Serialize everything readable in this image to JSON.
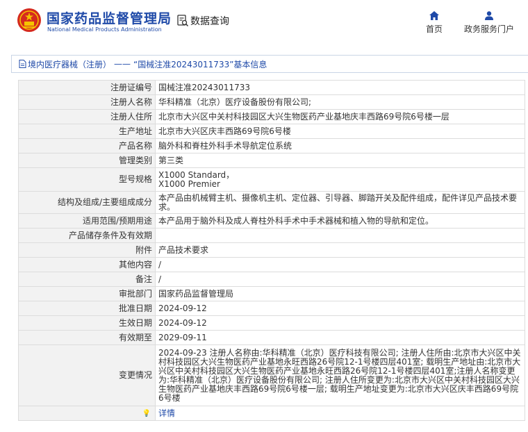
{
  "header": {
    "site_title": "国家药品监督管理局",
    "site_subtitle": "National Medical Products Administration",
    "data_query_label": "数据查询",
    "nav": [
      {
        "label": "首页",
        "icon": "home-icon"
      },
      {
        "label": "政务服务门户",
        "icon": "user-icon"
      }
    ],
    "accent_color": "#1f4aa8"
  },
  "breadcrumb": {
    "section_link": "境内医疗器械（注册）",
    "separator": "——",
    "title": "“国械注准20243011733”基本信息"
  },
  "rows": [
    {
      "label": "注册证编号",
      "value": "国械注准20243011733"
    },
    {
      "label": "注册人名称",
      "value": "华科精准（北京）医疗设备股份有限公司;"
    },
    {
      "label": "注册人住所",
      "value": "北京市大兴区中关村科技园区大兴生物医药产业基地庆丰西路69号院6号楼一层"
    },
    {
      "label": "生产地址",
      "value": "北京市大兴区庆丰西路69号院6号楼"
    },
    {
      "label": "产品名称",
      "value": "脑外科和脊柱外科手术导航定位系统"
    },
    {
      "label": "管理类别",
      "value": "第三类"
    },
    {
      "label": "型号规格",
      "value_lines": [
        "X1000 Standard，",
        "X1000 Premier"
      ]
    },
    {
      "label": "结构及组成/主要组成成分",
      "value": "本产品由机械臂主机、摄像机主机、定位器、引导器、脚踏开关及配件组成，配件详见产品技术要求。"
    },
    {
      "label": "适用范围/预期用途",
      "value": "本产品用于脑外科及成人脊柱外科手术中手术器械和植入物的导航和定位。"
    },
    {
      "label": "产品储存条件及有效期",
      "value": ""
    },
    {
      "label": "附件",
      "value": "产品技术要求"
    },
    {
      "label": "其他内容",
      "value": "/"
    },
    {
      "label": "备注",
      "value": "/"
    },
    {
      "label": "审批部门",
      "value": "国家药品监督管理局"
    },
    {
      "label": "批准日期",
      "value": "2024-09-12"
    },
    {
      "label": "生效日期",
      "value": "2024-09-12"
    },
    {
      "label": "有效期至",
      "value": "2029-09-11"
    },
    {
      "label": "变更情况",
      "value": "2024-09-23 注册人名称由:华科精准（北京）医疗科技有限公司; 注册人住所由:北京市大兴区中关村科技园区大兴生物医药产业基地永旺西路26号院12-1号楼四层401室; 载明生产地址由:北京市大兴区中关村科技园区大兴生物医药产业基地永旺西路26号院12-1号楼四层401室;注册人名称变更为:华科精准（北京）医疗设备股份有限公司; 注册人住所变更为:北京市大兴区中关村科技园区大兴生物医药产业基地庆丰西路69号院6号楼一层; 载明生产地址变更为:北京市大兴区庆丰西路69号院6号楼"
    }
  ],
  "details_row": {
    "label_icon": "bulb-icon",
    "link": "详情"
  }
}
